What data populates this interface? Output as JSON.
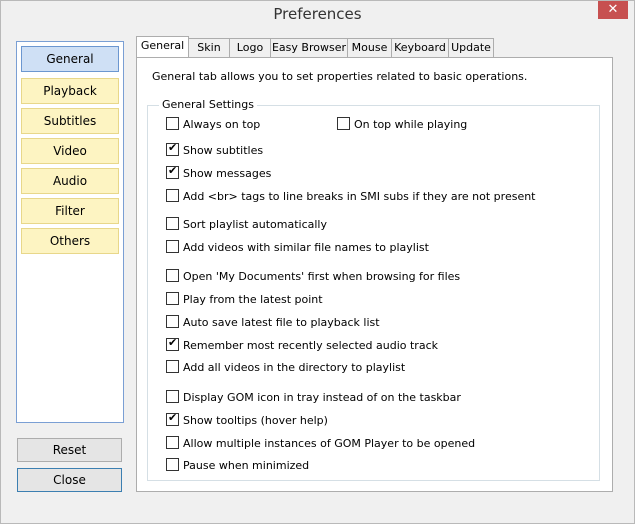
{
  "window": {
    "title": "Preferences",
    "close_glyph": "✕"
  },
  "sidebar": {
    "items": [
      {
        "label": "General",
        "active": true
      },
      {
        "label": "Playback",
        "active": false
      },
      {
        "label": "Subtitles",
        "active": false
      },
      {
        "label": "Video",
        "active": false
      },
      {
        "label": "Audio",
        "active": false
      },
      {
        "label": "Filter",
        "active": false
      },
      {
        "label": "Others",
        "active": false
      }
    ]
  },
  "buttons": {
    "reset": "Reset",
    "close": "Close"
  },
  "tabs": [
    {
      "label": "General",
      "active": true
    },
    {
      "label": "Skin"
    },
    {
      "label": "Logo"
    },
    {
      "label": "Easy Browser"
    },
    {
      "label": "Mouse"
    },
    {
      "label": "Keyboard"
    },
    {
      "label": "Update"
    }
  ],
  "panel": {
    "description": "General tab allows you to set properties related to basic operations.",
    "group_label": "General Settings",
    "options": [
      {
        "label": "Always on top",
        "checked": false
      },
      {
        "label": "On top while playing",
        "checked": false
      },
      {
        "label": "Show subtitles",
        "checked": true
      },
      {
        "label": "Show messages",
        "checked": true
      },
      {
        "label": "Add <br> tags to line breaks in SMI subs if they are not present",
        "checked": false
      },
      {
        "label": "Sort playlist automatically",
        "checked": false
      },
      {
        "label": "Add videos with similar file names to playlist",
        "checked": false
      },
      {
        "label": "Open 'My Documents' first when browsing for files",
        "checked": false
      },
      {
        "label": "Play from the latest point",
        "checked": false
      },
      {
        "label": "Auto save latest file to playback list",
        "checked": false
      },
      {
        "label": "Remember most recently selected audio track",
        "checked": true
      },
      {
        "label": "Add all videos in the directory to playlist",
        "checked": false
      },
      {
        "label": "Display GOM icon in tray instead of on the taskbar",
        "checked": false
      },
      {
        "label": "Show tooltips (hover help)",
        "checked": true
      },
      {
        "label": "Allow multiple instances of GOM Player to be opened",
        "checked": false
      },
      {
        "label": "Pause when minimized",
        "checked": false
      }
    ]
  },
  "check_glyph": "✔"
}
